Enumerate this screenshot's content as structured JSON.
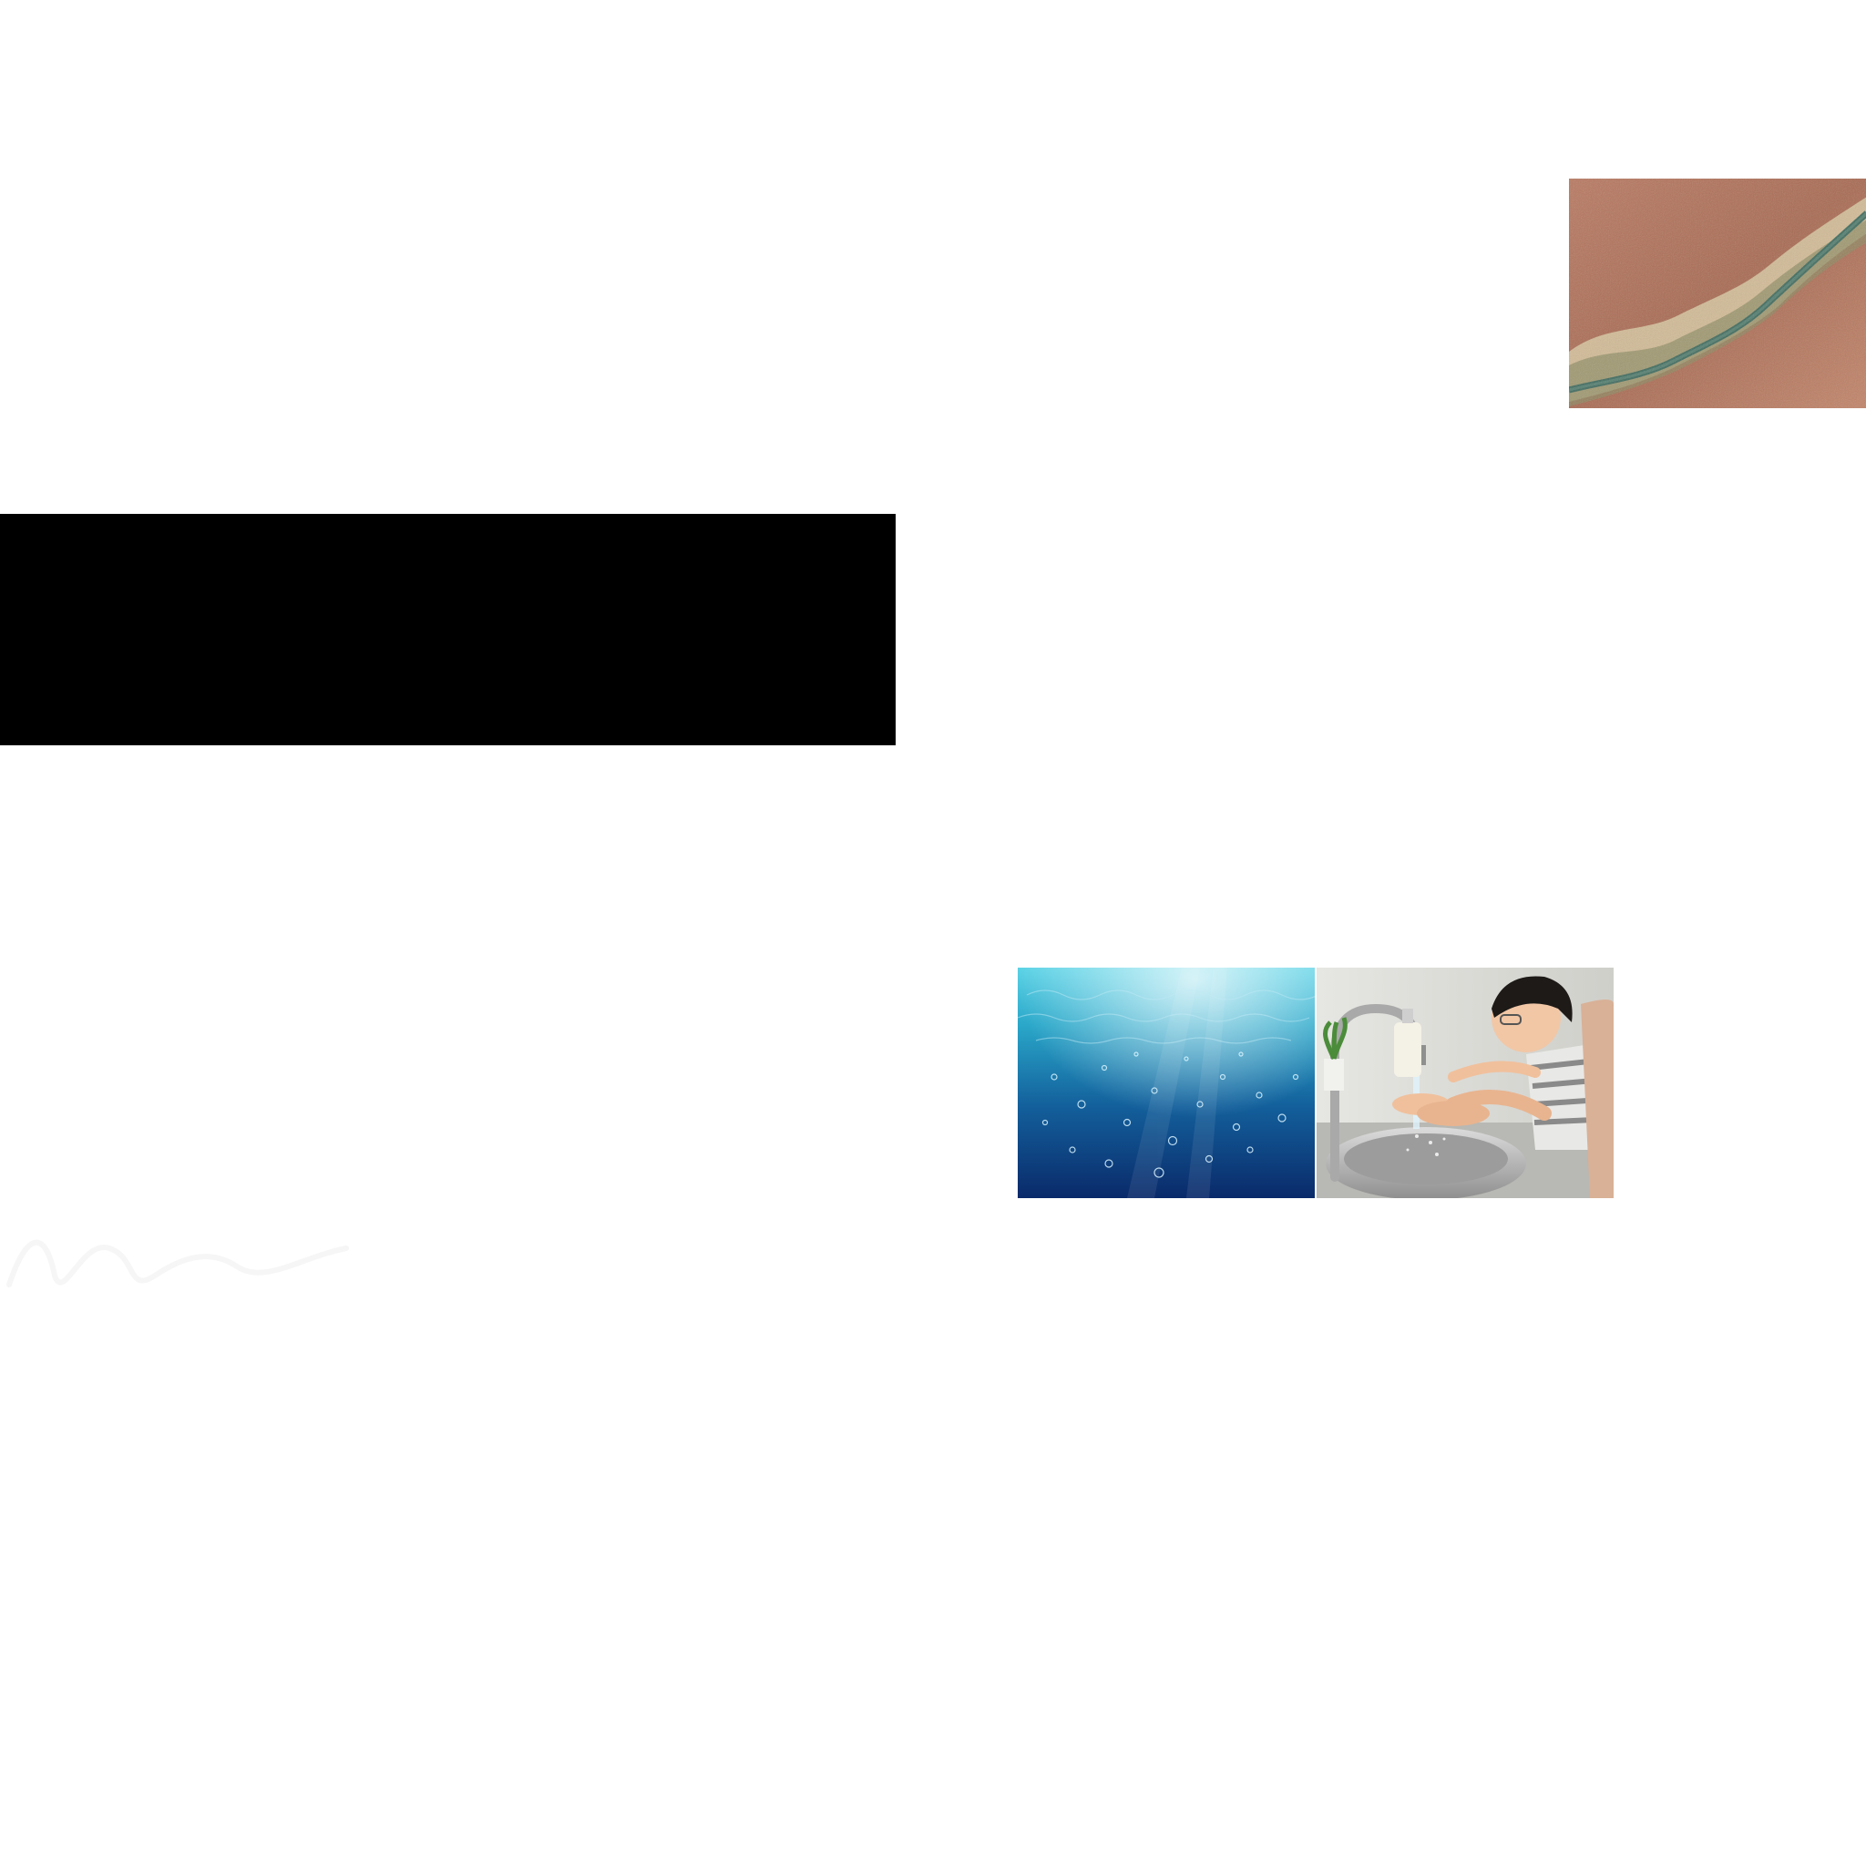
{
  "images": {
    "canyon": {
      "name": "aerial-canyon-river-photo"
    },
    "banner": {
      "name": "black-banner",
      "color": "#000000"
    },
    "underwater": {
      "name": "underwater-bubbles-photo"
    },
    "handwash": {
      "name": "child-washing-hands-photo"
    }
  },
  "colors": {
    "background": "#ffffff",
    "banner": "#000000",
    "ocean_light": "#37b9d6",
    "ocean_dark": "#0b2c6e",
    "desert": "#b8735a",
    "river": "#3f6b5e"
  }
}
